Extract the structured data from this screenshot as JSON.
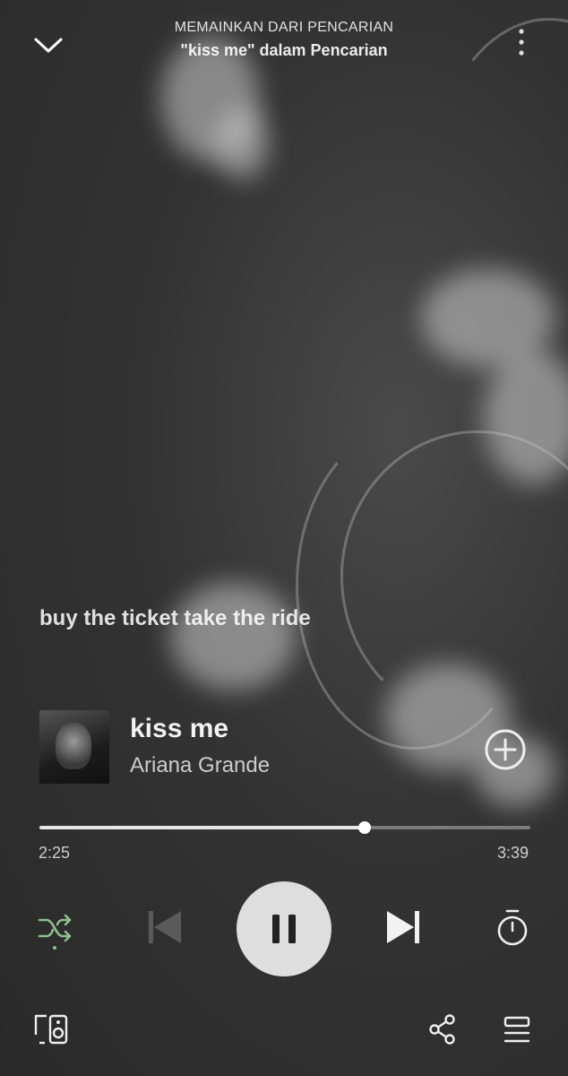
{
  "header": {
    "context_type": "MEMAINKAN DARI PENCARIAN",
    "context_name": "\"kiss me\" dalam Pencarian",
    "collapse_icon": "chevron-down-icon",
    "more_icon": "more-vertical-icon"
  },
  "lyrics": {
    "current_line": "buy the ticket take the ride"
  },
  "track": {
    "title": "kiss me",
    "artist": "Ariana Grande",
    "add_icon": "plus-circle-icon"
  },
  "playback": {
    "elapsed": "2:25",
    "total": "3:39",
    "progress_fraction": 0.662,
    "state": "playing"
  },
  "controls": {
    "shuffle_icon": "shuffle-icon",
    "shuffle_active": true,
    "previous_icon": "skip-previous-icon",
    "pause_icon": "pause-icon",
    "next_icon": "skip-next-icon",
    "timer_icon": "sleep-timer-icon"
  },
  "footer": {
    "devices_icon": "connect-devices-icon",
    "share_icon": "share-icon",
    "queue_icon": "queue-icon"
  },
  "colors": {
    "accent_active": "#8fbf8f",
    "text_primary": "#ffffff",
    "play_button": "#dedede"
  }
}
